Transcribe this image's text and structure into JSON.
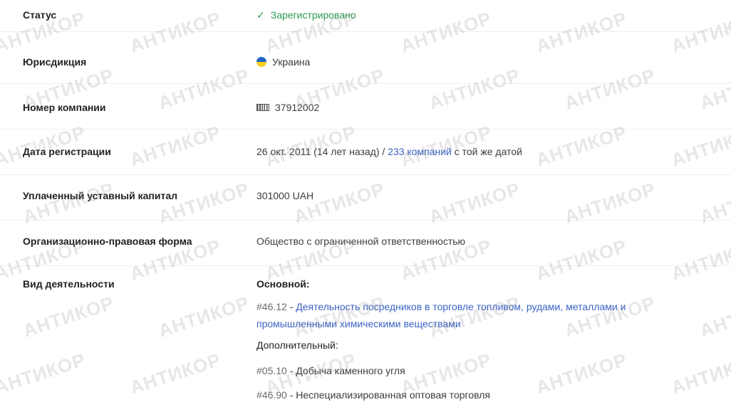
{
  "rows": [
    {
      "label": "Статус",
      "value": "Зарегистрировано"
    },
    {
      "label": "Юрисдикция",
      "value": "Украина"
    },
    {
      "label": "Номер компании",
      "value": "37912002"
    },
    {
      "label": "Дата регистрации",
      "date": "26 окт. 2011 (14 лет назад) / ",
      "link": "233 компаний",
      "suffix": " с той же датой"
    },
    {
      "label": "Уплаченный уставный капитал",
      "value": "301000 UAH"
    },
    {
      "label": "Организационно-правовая форма",
      "value": "Общество с ограниченной ответственностью"
    }
  ],
  "activity": {
    "label": "Вид деятельности",
    "main_title": "Основной:",
    "main_code": "#46.12",
    "main_text": "Деятельность посредников в торговле топливом, рудами, металлами и промышленными химическими веществами",
    "extra_title": "Дополнительный:",
    "extra": [
      {
        "code": "#05.10",
        "text": "Добыча каменного угля"
      },
      {
        "code": "#46.90",
        "text": "Неспециализированная оптовая торговля"
      }
    ]
  },
  "watermark": "АНТИКОР",
  "colors": {
    "status_green": "#2e9b4f",
    "link_blue": "#3b63c4"
  },
  "icons": {
    "status": "check-icon",
    "jurisdiction": "ukraine-flag-icon",
    "company_number": "barcode-icon"
  }
}
